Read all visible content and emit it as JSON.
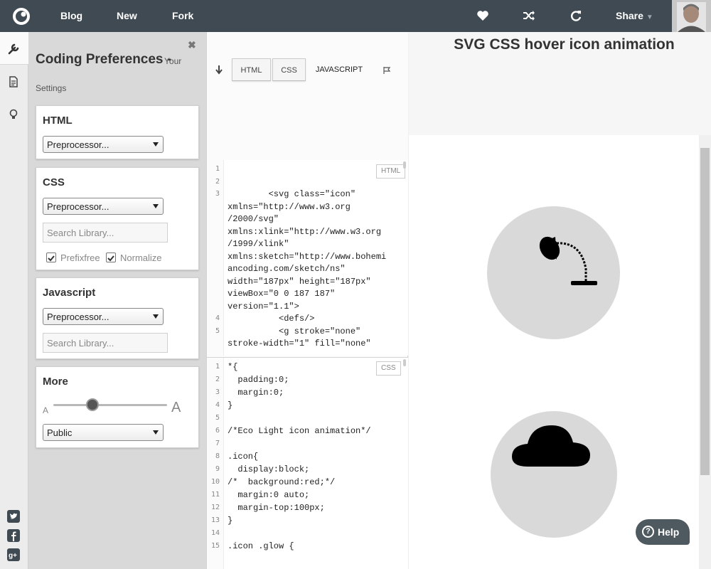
{
  "topbar": {
    "nav": [
      "Blog",
      "New",
      "Fork"
    ],
    "share_label": "Share",
    "icons": [
      "codepen-logo-icon",
      "heart-icon",
      "shuffle-icon",
      "refresh-icon",
      "user-avatar"
    ]
  },
  "rail": {
    "items": [
      "wrench-icon",
      "document-icon",
      "lightbulb-icon"
    ],
    "social": [
      "twitter-icon",
      "facebook-icon",
      "google-plus-icon"
    ]
  },
  "prefs": {
    "title": "Coding Preferences -",
    "subtitle_inline": "Your",
    "subtitle": "Settings",
    "html_card": {
      "title": "HTML",
      "select": "Preprocessor..."
    },
    "css_card": {
      "title": "CSS",
      "select": "Preprocessor...",
      "search_placeholder": "Search Library...",
      "checkbox1": "Prefixfree",
      "checkbox2": "Normalize"
    },
    "js_card": {
      "title": "Javascript",
      "select": "Preprocessor...",
      "search_placeholder": "Search Library..."
    },
    "more_card": {
      "title": "More",
      "font_small": "A",
      "font_large": "A",
      "visibility": "Public"
    }
  },
  "editor": {
    "tabs": [
      "HTML",
      "CSS",
      "JAVASCRIPT"
    ],
    "active_tab": "JAVASCRIPT",
    "html_badge": "HTML",
    "css_badge": "CSS",
    "html_lines": [
      {
        "n": "1",
        "t": ""
      },
      {
        "n": "2",
        "t": ""
      },
      {
        "n": "3",
        "t": "        <svg class=\"icon\""
      },
      {
        "n": "",
        "t": "xmlns=\"http://www.w3.org"
      },
      {
        "n": "",
        "t": "/2000/svg\""
      },
      {
        "n": "",
        "t": "xmlns:xlink=\"http://www.w3.org"
      },
      {
        "n": "",
        "t": "/1999/xlink\""
      },
      {
        "n": "",
        "t": "xmlns:sketch=\"http://www.bohemi"
      },
      {
        "n": "",
        "t": "ancoding.com/sketch/ns\""
      },
      {
        "n": "",
        "t": "width=\"187px\" height=\"187px\""
      },
      {
        "n": "",
        "t": "viewBox=\"0 0 187 187\""
      },
      {
        "n": "",
        "t": "version=\"1.1\">"
      },
      {
        "n": "4",
        "t": "          <defs/>"
      },
      {
        "n": "5",
        "t": "          <g stroke=\"none\""
      },
      {
        "n": "",
        "t": "stroke-width=\"1\" fill=\"none\""
      }
    ],
    "css_lines": [
      {
        "n": "1",
        "t": "*{"
      },
      {
        "n": "2",
        "t": "  padding:0;"
      },
      {
        "n": "3",
        "t": "  margin:0;"
      },
      {
        "n": "4",
        "t": "}"
      },
      {
        "n": "5",
        "t": ""
      },
      {
        "n": "6",
        "t": "/*Eco Light icon animation*/"
      },
      {
        "n": "7",
        "t": ""
      },
      {
        "n": "8",
        "t": ".icon{"
      },
      {
        "n": "9",
        "t": "  display:block;"
      },
      {
        "n": "10",
        "t": "/*  background:red;*/"
      },
      {
        "n": "11",
        "t": "  margin:0 auto;"
      },
      {
        "n": "12",
        "t": "  margin-top:100px;"
      },
      {
        "n": "13",
        "t": "}"
      },
      {
        "n": "14",
        "t": ""
      },
      {
        "n": "15",
        "t": ".icon .glow {"
      }
    ]
  },
  "preview": {
    "title": "SVG CSS hover icon animation",
    "icons": [
      "desk-lamp-icon",
      "cloud-icon"
    ]
  },
  "help": {
    "label": "Help",
    "q": "?"
  },
  "colors": {
    "topbar": "#3f4a52",
    "panel": "#d9d9d9",
    "accent": "#4e5960",
    "circle": "#d9d9d9"
  }
}
